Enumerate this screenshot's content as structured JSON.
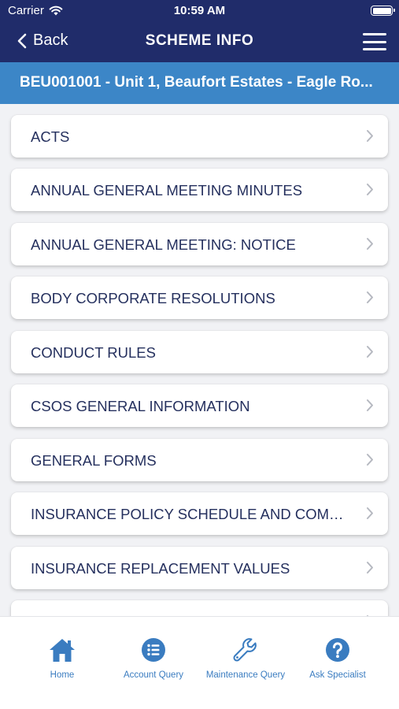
{
  "status_bar": {
    "carrier": "Carrier",
    "time": "10:59 AM"
  },
  "nav": {
    "back_label": "Back",
    "title": "SCHEME INFO"
  },
  "scheme": {
    "label": "BEU001001 - Unit 1, Beaufort Estates - Eagle Ro..."
  },
  "documents": [
    {
      "label": "ACTS"
    },
    {
      "label": "ANNUAL GENERAL MEETING MINUTES"
    },
    {
      "label": "ANNUAL GENERAL MEETING: NOTICE"
    },
    {
      "label": "BODY CORPORATE RESOLUTIONS"
    },
    {
      "label": "CONDUCT RULES"
    },
    {
      "label": "CSOS GENERAL INFORMATION"
    },
    {
      "label": "GENERAL FORMS"
    },
    {
      "label": "INSURANCE POLICY SCHEDULE AND COMPLI..."
    },
    {
      "label": "INSURANCE REPLACEMENT VALUES"
    },
    {
      "label": ""
    }
  ],
  "tabs": [
    {
      "label": "Home",
      "icon": "home-icon"
    },
    {
      "label": "Account Query",
      "icon": "list-icon"
    },
    {
      "label": "Maintenance Query",
      "icon": "wrench-icon"
    },
    {
      "label": "Ask Specialist",
      "icon": "help-icon"
    }
  ],
  "colors": {
    "nav": "#202c6a",
    "banner": "#3c86c7",
    "accent": "#3a7cc0",
    "text": "#25305e"
  }
}
